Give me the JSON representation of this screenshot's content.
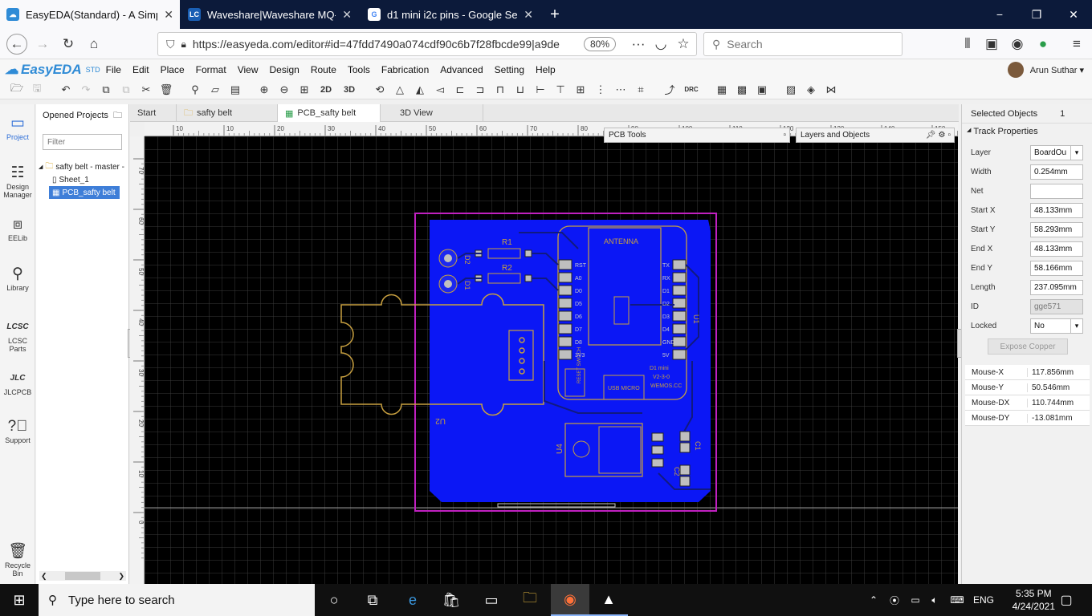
{
  "browser": {
    "tabs": [
      {
        "favicon": "easyeda",
        "title": "EasyEDA(Standard) - A Simple a",
        "active": true
      },
      {
        "favicon": "LC",
        "title": "Waveshare|Waveshare MQ-3 G",
        "active": false
      },
      {
        "favicon": "google",
        "title": "d1 mini i2c pins - Google Searc",
        "active": false
      }
    ],
    "new_tab": "+",
    "url": "https://easyeda.com/editor#id=47fdd7490a074cdf90c6b7f28fbcde99|a9de",
    "zoom": "80%",
    "search_placeholder": "Search",
    "window_controls": {
      "minimize": "−",
      "restore": "❐",
      "close": "✕"
    }
  },
  "app": {
    "logo": "EasyEDA",
    "logo_edition": "STD",
    "menus": [
      "File",
      "Edit",
      "Place",
      "Format",
      "View",
      "Design",
      "Route",
      "Tools",
      "Fabrication",
      "Advanced",
      "Setting",
      "Help"
    ],
    "user": "Arun Suthar ▾",
    "toolbar_text": {
      "twod": "2D",
      "threed": "3D",
      "drc": "DRC"
    }
  },
  "rail": [
    {
      "label": "Project",
      "icon": "project-icon"
    },
    {
      "label": "Design Manager",
      "icon": "design-manager-icon"
    },
    {
      "label": "EELib",
      "icon": "eelib-icon"
    },
    {
      "label": "Library",
      "icon": "library-icon"
    },
    {
      "label": "LCSC Parts",
      "icon": "lcsc-icon"
    },
    {
      "label": "JLCPCB",
      "icon": "jlcpcb-icon"
    },
    {
      "label": "Support",
      "icon": "support-icon"
    },
    {
      "label": "Recycle Bin",
      "icon": "recycle-bin-icon"
    }
  ],
  "projects": {
    "header": "Opened Projects",
    "filter_placeholder": "Filter",
    "tree": [
      {
        "label": "safty belt - master -",
        "level": 0,
        "selected": false
      },
      {
        "label": "Sheet_1",
        "level": 1,
        "selected": false
      },
      {
        "label": "PCB_safty belt",
        "level": 1,
        "selected": true
      }
    ]
  },
  "doc_tabs": [
    {
      "label": "Start",
      "active": false
    },
    {
      "label": "safty belt",
      "active": false
    },
    {
      "label": "PCB_safty belt",
      "active": true
    },
    {
      "label": "3D View",
      "active": false
    }
  ],
  "panels": {
    "pcb_tools": "PCB Tools",
    "layers": "Layers and Objects"
  },
  "rulers": {
    "h": [
      "10",
      "10",
      "20",
      "30",
      "40",
      "50",
      "60",
      "70",
      "80",
      "90",
      "100",
      "110",
      "120",
      "130",
      "140",
      "150"
    ],
    "v": [
      "70",
      "60",
      "50",
      "40",
      "30",
      "20",
      "10",
      "0"
    ]
  },
  "pcb": {
    "labels": {
      "r1": "R1",
      "r2": "R2",
      "d1": "D1",
      "d2": "D2",
      "antenna": "ANTENNA",
      "left_pins": [
        "RST",
        "A0",
        "D0",
        "D5",
        "D6",
        "D7",
        "D8",
        "3V3"
      ],
      "right_pins": [
        "TX",
        "RX",
        "D1",
        "D2",
        "D3",
        "D4",
        "GND",
        "5V"
      ],
      "board_text": [
        "D1 mini",
        "V2-3-0",
        "WEMOS.CC"
      ],
      "usb": "USB MICRO",
      "reset": "RESET SWITCH",
      "u1": "U1",
      "u2": "U2",
      "u4": "U4",
      "c1": "C1",
      "c2": "C2"
    }
  },
  "properties": {
    "selected_label": "Selected Objects",
    "selected_count": "1",
    "section": "Track Properties",
    "fields": [
      {
        "label": "Layer",
        "value": "BoardOu",
        "type": "select"
      },
      {
        "label": "Width",
        "value": "0.254mm",
        "type": "input"
      },
      {
        "label": "Net",
        "value": "",
        "type": "input"
      },
      {
        "label": "Start X",
        "value": "48.133mm",
        "type": "input"
      },
      {
        "label": "Start Y",
        "value": "58.293mm",
        "type": "input"
      },
      {
        "label": "End X",
        "value": "48.133mm",
        "type": "input"
      },
      {
        "label": "End Y",
        "value": "58.166mm",
        "type": "input"
      },
      {
        "label": "Length",
        "value": "237.095mm",
        "type": "input"
      },
      {
        "label": "ID",
        "value": "gge571",
        "type": "disabled"
      },
      {
        "label": "Locked",
        "value": "No",
        "type": "select"
      }
    ],
    "expose_button": "Expose Copper",
    "mouse": [
      {
        "label": "Mouse-X",
        "value": "117.856mm"
      },
      {
        "label": "Mouse-Y",
        "value": "50.546mm"
      },
      {
        "label": "Mouse-DX",
        "value": "110.744mm"
      },
      {
        "label": "Mouse-DY",
        "value": "-13.081mm"
      }
    ]
  },
  "taskbar": {
    "search_placeholder": "Type here to search",
    "lang": "ENG",
    "time": "5:35 PM",
    "date": "4/24/2021"
  },
  "colors": {
    "copper_fill": "#0b17f5",
    "board_outline": "#c020c0",
    "silkscreen": "#c8a040",
    "tab_strip": "#0c1a3a",
    "accent": "#3e7ed8"
  }
}
